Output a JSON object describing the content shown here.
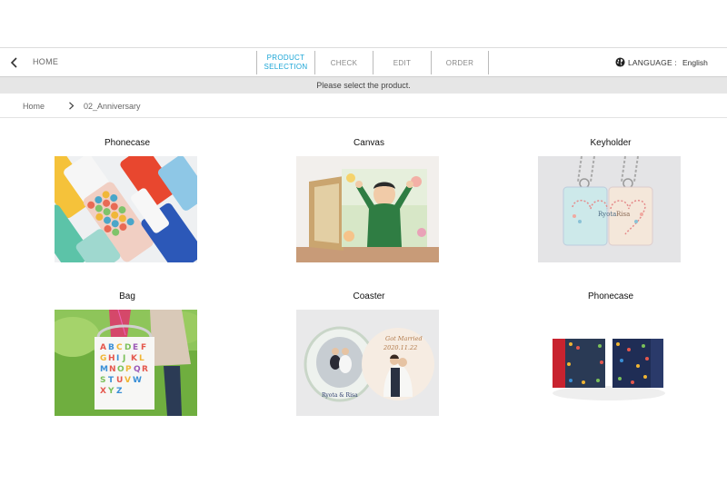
{
  "nav": {
    "home_label": "HOME",
    "steps": [
      {
        "label_line1": "PRODUCT",
        "label_line2": "SELECTION",
        "active": true
      },
      {
        "label": "CHECK"
      },
      {
        "label": "EDIT"
      },
      {
        "label": "ORDER"
      }
    ],
    "language_label": "LANGUAGE :",
    "language_value": "English"
  },
  "notice": "Please select the product.",
  "breadcrumb": {
    "home": "Home",
    "current": "02_Anniversary"
  },
  "products": [
    {
      "name": "Phonecase",
      "image_icon": "phonecase-pattern-photo"
    },
    {
      "name": "Canvas",
      "image_icon": "canvas-child-photo"
    },
    {
      "name": "Keyholder",
      "image_icon": "keyholder-photo"
    },
    {
      "name": "Bag",
      "image_icon": "alphabet-bag-photo"
    },
    {
      "name": "Coaster",
      "image_icon": "wedding-coaster-photo"
    },
    {
      "name": "Phonecase",
      "image_icon": "notebook-phonecase-photo"
    }
  ],
  "colors": {
    "accent": "#1aa5d6",
    "notice_bg": "#e6e6e6"
  },
  "photo_text": {
    "keyholder_left": "Ryota",
    "keyholder_right": "Risa",
    "coaster_left_caption": "Ryota & Risa",
    "coaster_right_title": "Got Married",
    "coaster_right_date": "2020.11.22"
  }
}
